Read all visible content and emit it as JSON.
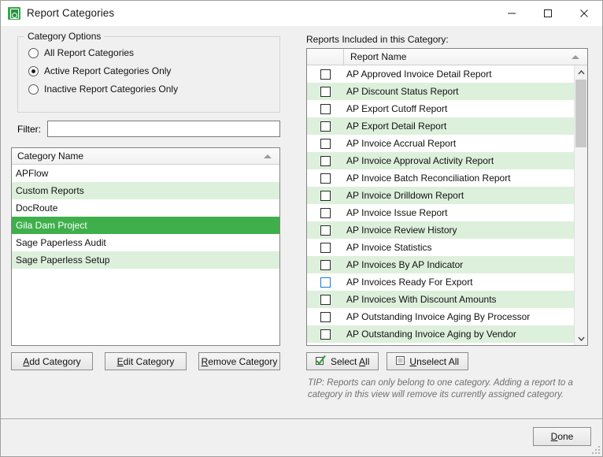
{
  "window": {
    "title": "Report Categories",
    "icon": "report-categories-icon",
    "minimize_icon": "minimize-icon",
    "maximize_icon": "maximize-icon",
    "close_icon": "close-icon"
  },
  "category_options": {
    "legend": "Category Options",
    "radios": [
      {
        "label": "All Report Categories",
        "checked": false
      },
      {
        "label": "Active Report Categories Only",
        "checked": true
      },
      {
        "label": "Inactive Report Categories Only",
        "checked": false
      }
    ]
  },
  "filter": {
    "label": "Filter:",
    "value": "",
    "placeholder": ""
  },
  "category_grid": {
    "header": "Category Name",
    "sort_icon": "sort-ascending-icon",
    "rows": [
      {
        "name": "APFlow",
        "selected": false
      },
      {
        "name": "Custom Reports",
        "selected": false
      },
      {
        "name": "DocRoute",
        "selected": false
      },
      {
        "name": "Gila Dam Project",
        "selected": true
      },
      {
        "name": "Sage Paperless Audit",
        "selected": false
      },
      {
        "name": "Sage Paperless Setup",
        "selected": false
      }
    ]
  },
  "category_buttons": [
    {
      "accel": "A",
      "rest": "dd Category",
      "name": "add-category-button"
    },
    {
      "accel": "E",
      "rest": "dit Category",
      "name": "edit-category-button"
    },
    {
      "accel": "R",
      "rest": "emove Category",
      "name": "remove-category-button"
    }
  ],
  "reports_panel": {
    "title": "Reports Included in this Category:",
    "header_name": "Report Name",
    "sort_icon": "sort-ascending-icon",
    "scroll_up_icon": "chevron-up-icon",
    "scroll_down_icon": "chevron-down-icon",
    "rows": [
      {
        "name": "AP Approved Invoice Detail Report",
        "checked": false,
        "focused": false
      },
      {
        "name": "AP Discount Status Report",
        "checked": false,
        "focused": false
      },
      {
        "name": "AP Export Cutoff Report",
        "checked": false,
        "focused": false
      },
      {
        "name": "AP Export Detail Report",
        "checked": false,
        "focused": false
      },
      {
        "name": "AP Invoice Accrual Report",
        "checked": false,
        "focused": false
      },
      {
        "name": "AP Invoice Approval Activity Report",
        "checked": false,
        "focused": false
      },
      {
        "name": "AP Invoice Batch Reconciliation Report",
        "checked": false,
        "focused": false
      },
      {
        "name": "AP Invoice Drilldown Report",
        "checked": false,
        "focused": false
      },
      {
        "name": "AP Invoice Issue Report",
        "checked": false,
        "focused": false
      },
      {
        "name": "AP Invoice Review History",
        "checked": false,
        "focused": false
      },
      {
        "name": "AP Invoice Statistics",
        "checked": false,
        "focused": false
      },
      {
        "name": "AP Invoices By AP Indicator",
        "checked": false,
        "focused": false
      },
      {
        "name": "AP Invoices Ready For Export",
        "checked": false,
        "focused": true
      },
      {
        "name": "AP Invoices With Discount Amounts",
        "checked": false,
        "focused": false
      },
      {
        "name": "AP Outstanding Invoice Aging By Processor",
        "checked": false,
        "focused": false
      },
      {
        "name": "AP Outstanding Invoice Aging by Vendor",
        "checked": false,
        "focused": false
      }
    ]
  },
  "select_buttons": {
    "select_all": {
      "accel": "A",
      "pre": "Select ",
      "rest": "ll",
      "icon": "green-check-icon"
    },
    "unselect_all": {
      "accel": "U",
      "pre": "",
      "rest": "nselect All",
      "icon": "empty-checkbox-icon"
    }
  },
  "tip": {
    "text": "TIP:  Reports can only belong to one category.  Adding a report to a category in this view will remove its currently assigned category."
  },
  "footer": {
    "done": {
      "accel": "D",
      "rest": "one"
    },
    "grip_icon": "resize-grip-icon"
  },
  "colors": {
    "selection_green": "#3faf4c",
    "row_alt_green": "#ddf0dc",
    "accent_icon_green": "#35a84c"
  }
}
